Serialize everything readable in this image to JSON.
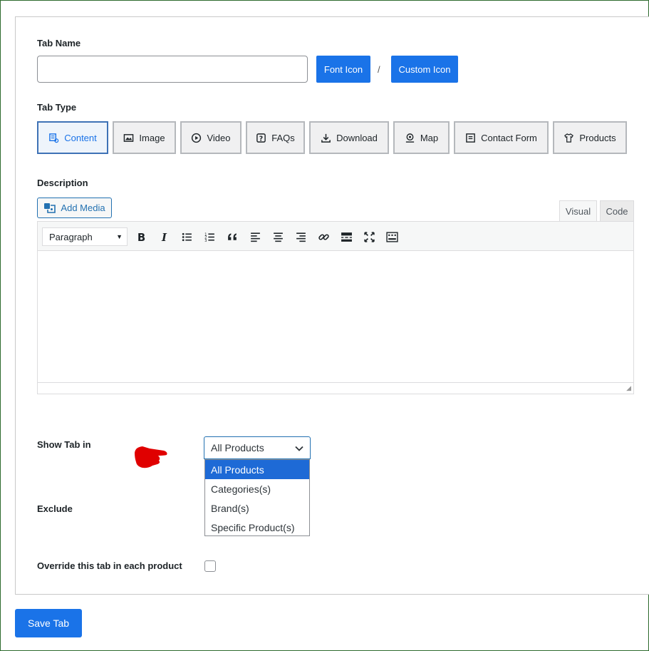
{
  "form": {
    "tab_name_label": "Tab Name",
    "tab_name_value": "",
    "font_icon_label": "Font Icon",
    "separator": "/",
    "custom_icon_label": "Custom Icon",
    "tab_type_label": "Tab Type",
    "tab_types": [
      {
        "label": "Content",
        "icon": "content-icon",
        "active": true
      },
      {
        "label": "Image",
        "icon": "image-icon",
        "active": false
      },
      {
        "label": "Video",
        "icon": "play-circle-icon",
        "active": false
      },
      {
        "label": "FAQs",
        "icon": "question-box-icon",
        "active": false
      },
      {
        "label": "Download",
        "icon": "download-icon",
        "active": false
      },
      {
        "label": "Map",
        "icon": "map-pin-icon",
        "active": false
      },
      {
        "label": "Contact Form",
        "icon": "form-icon",
        "active": false
      },
      {
        "label": "Products",
        "icon": "shirt-icon",
        "active": false
      }
    ],
    "description_label": "Description",
    "add_media_label": "Add Media",
    "editor_tabs": {
      "visual": "Visual",
      "code": "Code"
    },
    "format_select": "Paragraph",
    "toolbar_icons": [
      "bold-icon",
      "italic-icon",
      "bullet-list-icon",
      "numbered-list-icon",
      "blockquote-icon",
      "align-left-icon",
      "align-center-icon",
      "align-right-icon",
      "link-icon",
      "read-more-icon",
      "fullscreen-icon",
      "toolbar-toggle-icon"
    ],
    "show_tab_label": "Show Tab in",
    "show_tab_selected": "All Products",
    "show_tab_options": [
      "All Products",
      "Categories(s)",
      "Brand(s)",
      "Specific Product(s)"
    ],
    "exclude_label": "Exclude",
    "override_label": "Override this tab in each product",
    "override_checked": false,
    "save_label": "Save Tab"
  },
  "colors": {
    "primary": "#1a73e8",
    "selected_option": "#1e6ad6",
    "pointer": "#e00000"
  }
}
